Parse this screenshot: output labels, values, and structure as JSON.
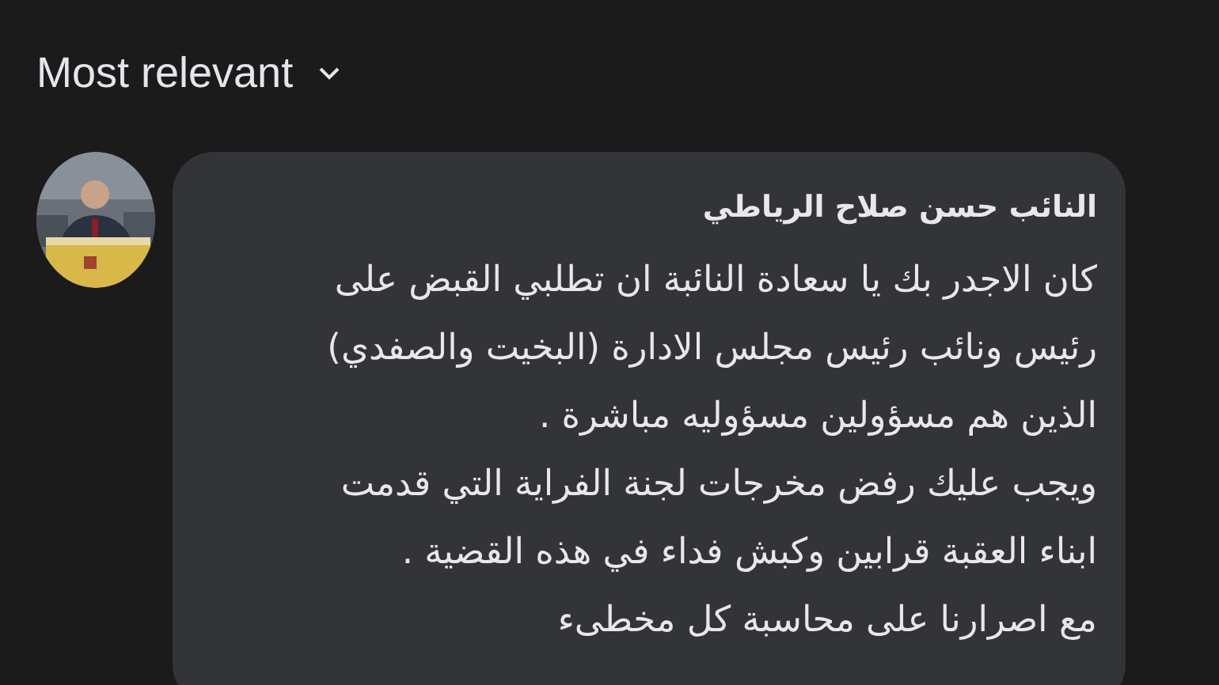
{
  "sort": {
    "label": "Most relevant"
  },
  "comment": {
    "author": "النائب حسن صلاح الرياطي",
    "lines": [
      "كان الاجدر بك يا سعادة النائبة ان تطلبي القبض على",
      "رئيس ونائب رئيس مجلس الادارة (البخيت والصفدي)",
      "الذين هم مسؤولين مسؤوليه مباشرة .",
      "ويجب عليك رفض مخرجات لجنة الفراية التي قدمت",
      "ابناء العقبة قرابين وكبش فداء في هذه القضية .",
      "مع اصرارنا على محاسبة كل مخطىء"
    ]
  }
}
